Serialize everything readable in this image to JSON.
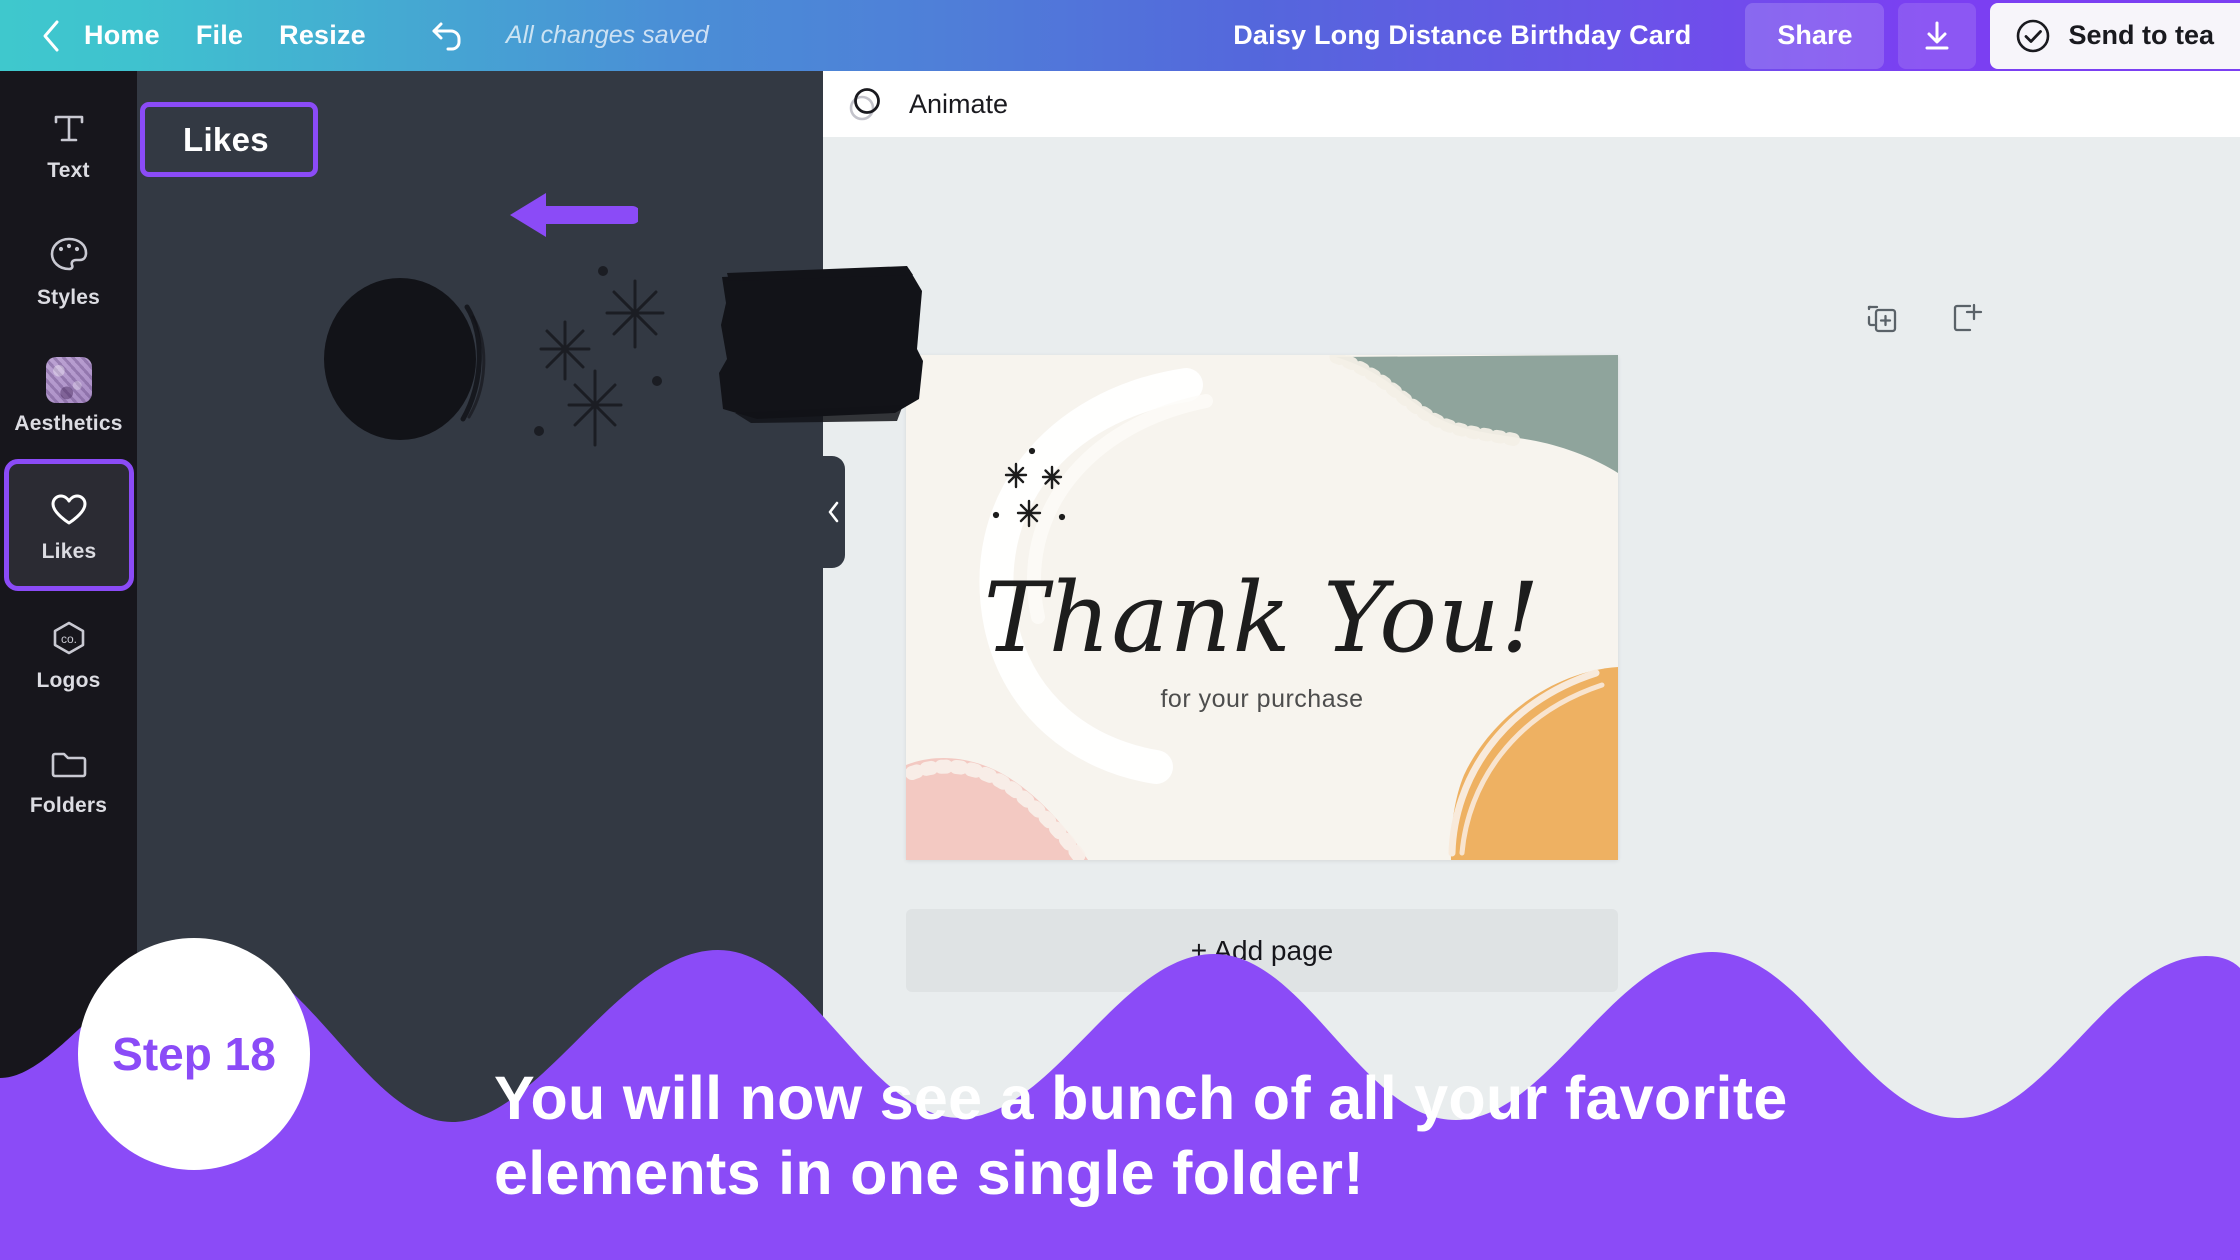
{
  "topbar": {
    "back_icon": "chevron-left-icon",
    "home_label": "Home",
    "file_label": "File",
    "resize_label": "Resize",
    "undo_icon": "undo-arrow-icon",
    "save_status": "All changes saved",
    "design_title": "Daisy Long Distance Birthday Card",
    "share_label": "Share",
    "download_icon": "download-icon",
    "send_check_icon": "check-circle-icon",
    "send_label": "Send to tea",
    "gradient_start": "#3fc8cd",
    "gradient_mid": "#4a8ed6",
    "gradient_end": "#7b3ff2"
  },
  "sidebar": {
    "items": [
      {
        "label": "Text",
        "icon": "text-t-icon",
        "active": false
      },
      {
        "label": "Styles",
        "icon": "palette-icon",
        "active": false
      },
      {
        "label": "Aesthetics",
        "icon": "aesthetics-thumbnail-icon",
        "active": false
      },
      {
        "label": "Likes",
        "icon": "heart-icon",
        "active": true
      },
      {
        "label": "Logos",
        "icon": "logo-hexagon-icon",
        "active": false
      },
      {
        "label": "Folders",
        "icon": "folder-icon",
        "active": false
      }
    ]
  },
  "panel": {
    "title": "Likes",
    "highlight_color": "#8b4bf7",
    "arrow_icon": "left-arrow-annotation-icon",
    "collapse_icon": "chevron-left-icon",
    "elements": [
      {
        "name": "brush-circle-element"
      },
      {
        "name": "sparkle-stars-element"
      },
      {
        "name": "brush-rectangle-element"
      }
    ]
  },
  "canvas": {
    "animate_label": "Animate",
    "animate_icon": "animate-circles-icon",
    "duplicate_page_icon": "duplicate-page-icon",
    "add_page_icon": "add-page-icon",
    "add_page_label": "+ Add page",
    "card": {
      "title": "Thank You!",
      "subtitle": "for your purchase",
      "background": "#f7f4ee",
      "accent_sage": "#8fa49c",
      "accent_pink": "#f3c9c2",
      "accent_orange": "#eeb162"
    }
  },
  "tutorial": {
    "step_label": "Step 18",
    "caption_line1": "You will now see a bunch of all your favorite",
    "caption_line2": "elements in one single folder!",
    "accent_color": "#8b4bf7"
  }
}
